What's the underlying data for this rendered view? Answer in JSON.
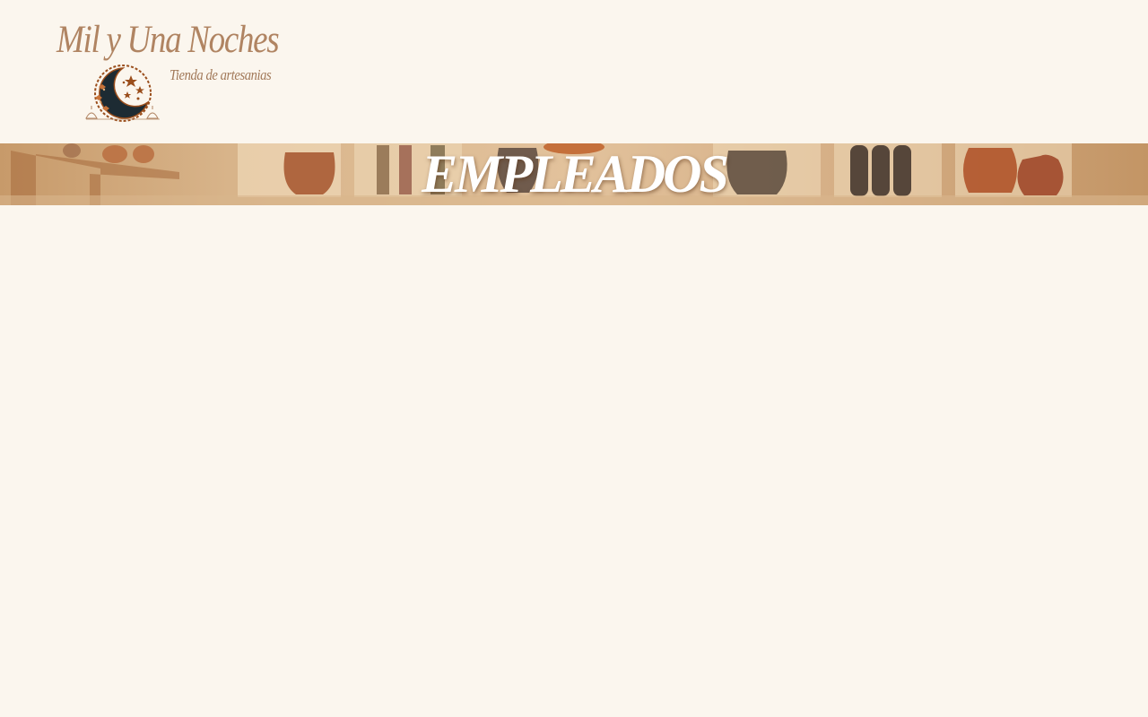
{
  "header": {
    "brand_title": "Mil y Una Noches",
    "tagline": "Tienda de artesanias",
    "logo_icon": "crescent-moon-stars-logo"
  },
  "banner": {
    "title": "EMPLEADOS"
  },
  "colors": {
    "background": "#fbf6ee",
    "brand": "#b08462",
    "logo_dark": "#1d2b33",
    "logo_accent": "#9a4e1c"
  }
}
